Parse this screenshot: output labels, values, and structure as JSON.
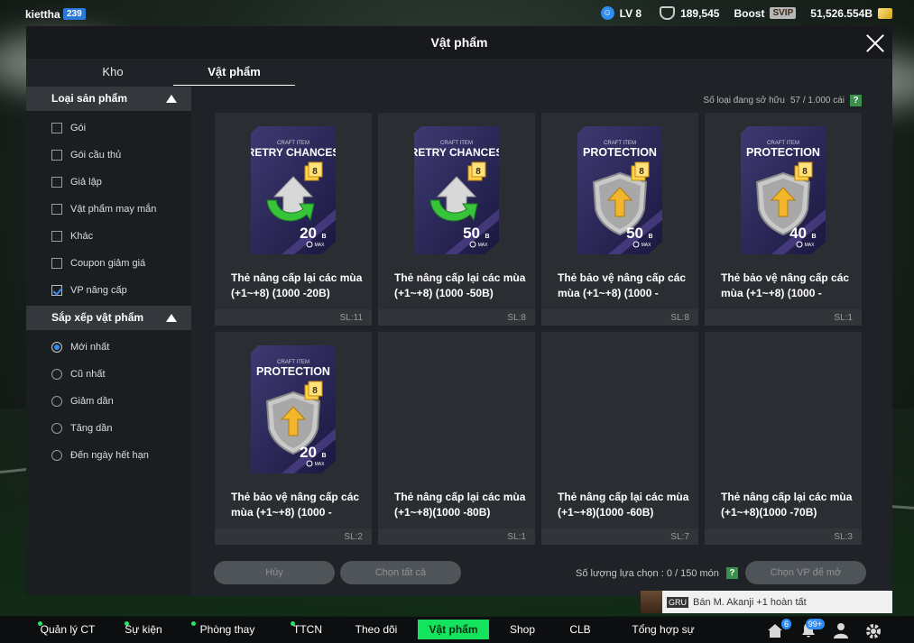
{
  "topbar": {
    "username": "kiettha",
    "user_badge": "239",
    "level": "LV 8",
    "coins": "189,545",
    "boost": "Boost",
    "svip": "SVIP",
    "bp": "51,526.554B"
  },
  "modal": {
    "title": "Vật phẩm",
    "tabs": [
      {
        "label": "Kho"
      },
      {
        "label": "Vật phẩm"
      }
    ]
  },
  "sidebar": {
    "category_title": "Loại sản phẩm",
    "categories": [
      {
        "label": "Gói",
        "checked": false
      },
      {
        "label": "Gói cầu thủ",
        "checked": false
      },
      {
        "label": "Giả lập",
        "checked": false
      },
      {
        "label": "Vật phẩm may mắn",
        "checked": false
      },
      {
        "label": "Khác",
        "checked": false
      },
      {
        "label": "Coupon giảm giá",
        "checked": false
      },
      {
        "label": "VP nâng cấp",
        "checked": true
      }
    ],
    "sort_title": "Sắp xếp vật phẩm",
    "sorts": [
      {
        "label": "Mới nhất",
        "selected": true
      },
      {
        "label": "Cũ nhất",
        "selected": false
      },
      {
        "label": "Giảm dần",
        "selected": false
      },
      {
        "label": "Tăng dần",
        "selected": false
      },
      {
        "label": "Đến ngày hết hạn",
        "selected": false
      }
    ]
  },
  "owned": {
    "label": "Số loại đang sở hữu",
    "value": "57 / 1.000 cái",
    "help": "?"
  },
  "items": [
    {
      "kind": "retry",
      "header": "CRAFT ITEM",
      "art_title": "RETRY CHANCES",
      "value": "20",
      "unit": "B",
      "max": "MAX",
      "level": "8",
      "name_line1": "Thẻ nâng cấp lại các mùa",
      "name_line2": "(+1~+8) (1000 -20B)",
      "qty": "SL:11"
    },
    {
      "kind": "retry",
      "header": "CRAFT ITEM",
      "art_title": "RETRY CHANCES",
      "value": "50",
      "unit": "B",
      "max": "MAX",
      "level": "8",
      "name_line1": "Thẻ nâng cấp lại các mùa",
      "name_line2": "(+1~+8) (1000 -50B)",
      "qty": "SL:8"
    },
    {
      "kind": "protect",
      "header": "CRAFT ITEM",
      "art_title": "PROTECTION",
      "value": "50",
      "unit": "B",
      "max": "MAX",
      "level": "8",
      "name_line1": "Thẻ bảo vệ nâng cấp các",
      "name_line2": "mùa (+1~+8) (1000 -",
      "qty": "SL:8"
    },
    {
      "kind": "protect",
      "header": "CRAFT ITEM",
      "art_title": "PROTECTION",
      "value": "40",
      "unit": "B",
      "max": "MAX",
      "level": "8",
      "name_line1": "Thẻ bảo vệ nâng cấp các",
      "name_line2": "mùa (+1~+8) (1000 -",
      "qty": "SL:1"
    },
    {
      "kind": "protect",
      "header": "CRAFT ITEM",
      "art_title": "PROTECTION",
      "value": "20",
      "unit": "B",
      "max": "MAX",
      "level": "8",
      "name_line1": "Thẻ bảo vệ nâng cấp các",
      "name_line2": "mùa (+1~+8) (1000 -",
      "qty": "SL:2"
    },
    {
      "kind": "none",
      "name_line1": "Thẻ nâng cấp lại các mùa",
      "name_line2": "(+1~+8)(1000 -80B)",
      "qty": "SL:1"
    },
    {
      "kind": "none",
      "name_line1": "Thẻ nâng cấp lại các mùa",
      "name_line2": "(+1~+8)(1000 -60B)",
      "qty": "SL:7"
    },
    {
      "kind": "none",
      "name_line1": "Thẻ nâng cấp lại các mùa",
      "name_line2": "(+1~+8)(1000 -70B)",
      "qty": "SL:3"
    }
  ],
  "actions": {
    "cancel": "Hủy",
    "select_all": "Chọn tất cả",
    "selected_label": "Số lượng lựa chọn : 0 / 150 món",
    "help": "?",
    "open": "Chọn VP để mở"
  },
  "toast": {
    "tag": "GRU",
    "text": "Bán M. Akanji +1 hoàn tất"
  },
  "bottomnav": {
    "items": [
      {
        "label": "Quản lý CT"
      },
      {
        "label": "Sự kiện"
      },
      {
        "label": "Phòng thay đồ"
      },
      {
        "label": "TTCN"
      },
      {
        "label": "Theo dõi"
      },
      {
        "label": "Vật phẩm"
      },
      {
        "label": "Shop"
      },
      {
        "label": "CLB"
      },
      {
        "label": "Tổng hợp sự kiện"
      }
    ],
    "home_badge": "6",
    "bell_badge": "99+"
  },
  "colors": {
    "accent_green": "#14e35e",
    "check_blue": "#2f8cf0",
    "panel": "#1f2226",
    "card": "#2a2d31"
  }
}
